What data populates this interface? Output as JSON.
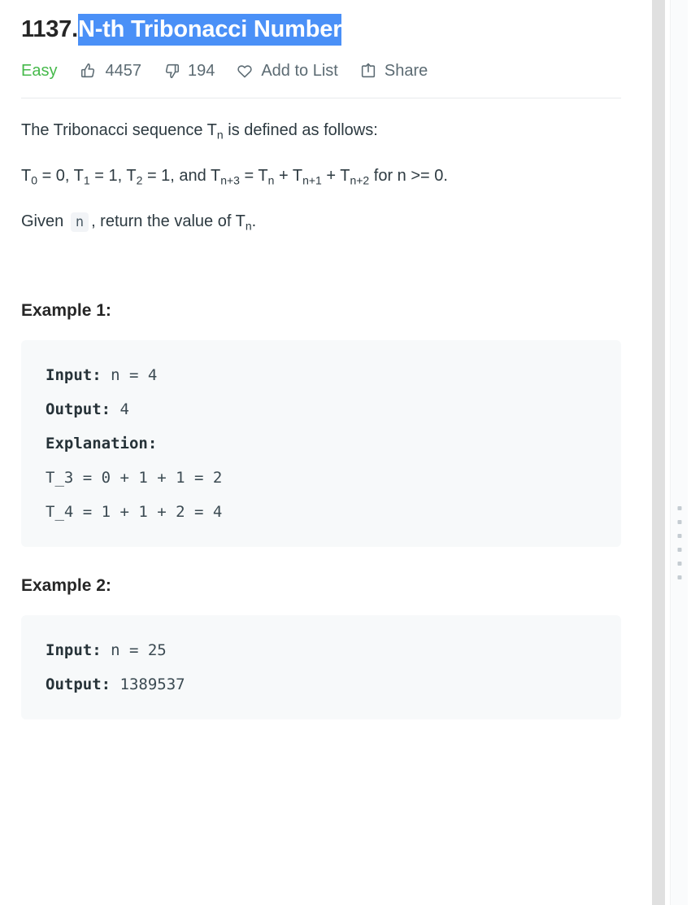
{
  "problem": {
    "number": "1137.",
    "title": "N-th Tribonacci Number",
    "difficulty": "Easy"
  },
  "actions": {
    "likes": "4457",
    "dislikes": "194",
    "add_to_list": "Add to List",
    "share": "Share"
  },
  "description": {
    "line1_a": "The Tribonacci sequence T",
    "line1_sub": "n",
    "line1_b": " is defined as follows:",
    "line2_p1": "T",
    "line2_s1": "0",
    "line2_p2": " = 0, T",
    "line2_s2": "1",
    "line2_p3": " = 1, T",
    "line2_s3": "2",
    "line2_p4": " = 1, and T",
    "line2_s4": "n+3",
    "line2_p5": " = T",
    "line2_s5": "n",
    "line2_p6": " + T",
    "line2_s6": "n+1",
    "line2_p7": " + T",
    "line2_s7": "n+2",
    "line2_p8": " for n >= 0.",
    "line3_a": "Given ",
    "line3_code": "n",
    "line3_b": ", return the value of T",
    "line3_sub": "n",
    "line3_c": "."
  },
  "examples": [
    {
      "heading": "Example 1:",
      "input_label": "Input:",
      "input_value": " n = 4",
      "output_label": "Output:",
      "output_value": " 4",
      "explanation_label": "Explanation:",
      "explanation_lines": [
        "T_3 = 0 + 1 + 1 = 2",
        "T_4 = 1 + 1 + 2 = 4"
      ]
    },
    {
      "heading": "Example 2:",
      "input_label": "Input:",
      "input_value": " n = 25",
      "output_label": "Output:",
      "output_value": " 1389537",
      "explanation_label": "",
      "explanation_lines": []
    }
  ],
  "colors": {
    "selection_highlight": "#4a90f7",
    "difficulty_easy": "#46b94b",
    "meta_text": "#5c6b73",
    "code_block_bg": "#f7f9fa",
    "body_text": "#2d3a41"
  }
}
